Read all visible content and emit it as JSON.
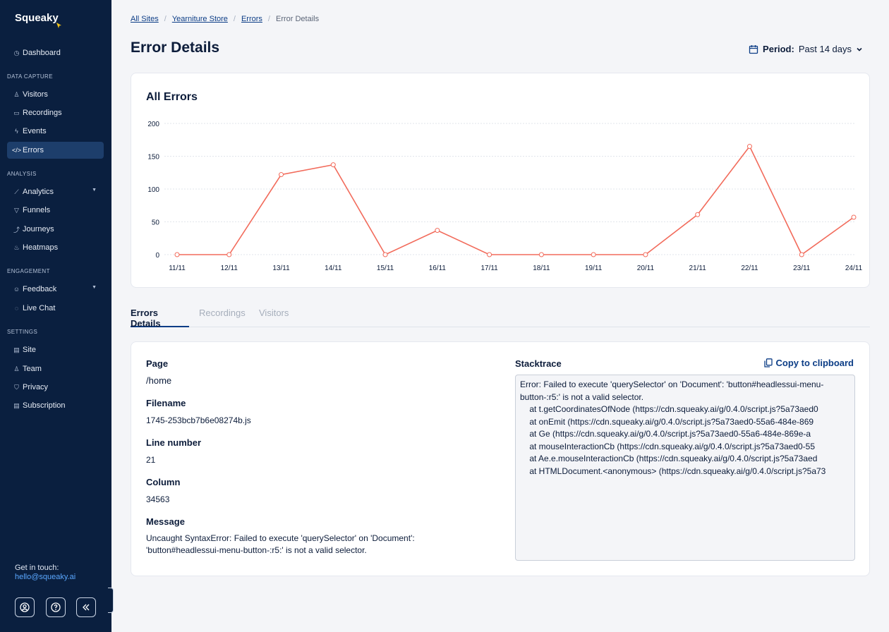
{
  "sidebar": {
    "logo": "Squeaky",
    "items": [
      {
        "label": "Dashboard",
        "icon": "dashboard-icon"
      },
      {
        "label": "Visitors",
        "icon": "visitors-icon"
      },
      {
        "label": "Recordings",
        "icon": "recordings-icon"
      },
      {
        "label": "Events",
        "icon": "events-icon"
      },
      {
        "label": "Errors",
        "icon": "errors-icon",
        "active": true
      },
      {
        "label": "Analytics",
        "icon": "analytics-icon"
      },
      {
        "label": "Funnels",
        "icon": "funnels-icon"
      },
      {
        "label": "Journeys",
        "icon": "journeys-icon"
      },
      {
        "label": "Heatmaps",
        "icon": "heatmaps-icon"
      },
      {
        "label": "Feedback",
        "icon": "feedback-icon"
      },
      {
        "label": "Live Chat",
        "icon": "live-chat-icon"
      },
      {
        "label": "Site",
        "icon": "site-icon"
      },
      {
        "label": "Team",
        "icon": "team-icon"
      },
      {
        "label": "Privacy",
        "icon": "privacy-icon"
      },
      {
        "label": "Subscription",
        "icon": "subscription-icon"
      }
    ],
    "sections": [
      "DATA CAPTURE",
      "ANALYSIS",
      "ENGAGEMENT",
      "SETTINGS"
    ],
    "contact_label": "Get in touch:",
    "contact_email": "hello@squeaky.ai"
  },
  "breadcrumb": {
    "items": [
      "All Sites",
      "Yearniture Store",
      "Errors"
    ],
    "current": "Error Details"
  },
  "header": {
    "title": "Error Details",
    "period_label": "Period:",
    "period_value": "Past 14 days"
  },
  "chart_data": {
    "type": "line",
    "title": "All Errors",
    "categories": [
      "11/11",
      "12/11",
      "13/11",
      "14/11",
      "15/11",
      "16/11",
      "17/11",
      "18/11",
      "19/11",
      "20/11",
      "21/11",
      "22/11",
      "23/11",
      "24/11"
    ],
    "series": [
      {
        "values": [
          0,
          0,
          122,
          137,
          0,
          37,
          0,
          0,
          0,
          0,
          61,
          165,
          0,
          57
        ]
      }
    ],
    "ylim": [
      0,
      200
    ],
    "yticks": [
      0,
      50,
      100,
      150,
      200
    ],
    "grid": true,
    "color": "#f26b5b"
  },
  "tabs": [
    {
      "label": "Errors Details",
      "active": true
    },
    {
      "label": "Recordings"
    },
    {
      "label": "Visitors"
    }
  ],
  "details": {
    "page_label": "Page",
    "page_value": "/home",
    "filename_label": "Filename",
    "filename_value": "1745-253bcb7b6e08274b.js",
    "line_label": "Line number",
    "line_value": "21",
    "column_label": "Column",
    "column_value": "34563",
    "message_label": "Message",
    "message_value": "Uncaught SyntaxError: Failed to execute 'querySelector' on 'Document': 'button#headlessui-menu-button-:r5:' is not a valid selector.",
    "stack_label": "Stacktrace",
    "copy_label": "Copy to clipboard",
    "stacktrace": "Error: Failed to execute 'querySelector' on 'Document': 'button#headlessui-menu-button-:r5:' is not a valid selector.\n    at t.getCoordinatesOfNode (https://cdn.squeaky.ai/g/0.4.0/script.js?5a73aed0\n    at onEmit (https://cdn.squeaky.ai/g/0.4.0/script.js?5a73aed0-55a6-484e-869\n    at Ge (https://cdn.squeaky.ai/g/0.4.0/script.js?5a73aed0-55a6-484e-869e-a\n    at mouseInteractionCb (https://cdn.squeaky.ai/g/0.4.0/script.js?5a73aed0-55\n    at Ae.e.mouseInteractionCb (https://cdn.squeaky.ai/g/0.4.0/script.js?5a73aed\n    at HTMLDocument.<anonymous> (https://cdn.squeaky.ai/g/0.4.0/script.js?5a73"
  },
  "colors": {
    "sidebar_bg": "#0a1f3f",
    "accent": "#0c3d86",
    "line": "#f26b5b"
  }
}
